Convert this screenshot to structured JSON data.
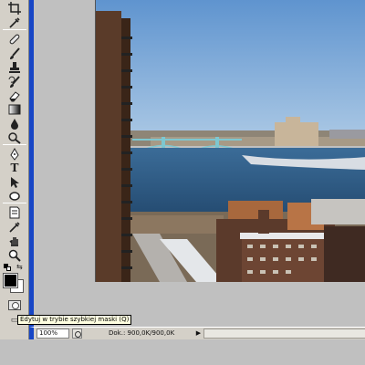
{
  "tooltip": {
    "text": "Edytuj w trybie szybkiej maski (Q)"
  },
  "statusbar": {
    "zoom": "100%",
    "doc_size": "Dok.: 900,0K/900,0K"
  },
  "toolbox": {
    "foreground_color": "#000000",
    "background_color": "#ffffff",
    "tools": [
      "crop-icon",
      "eyedropper-icon",
      "healing-brush-icon",
      "brush-icon",
      "clone-stamp-icon",
      "history-brush-icon",
      "eraser-icon",
      "gradient-icon",
      "blur-icon",
      "dodge-icon",
      "pen-icon",
      "type-icon",
      "path-selection-icon",
      "shape-icon",
      "notes-icon",
      "eyedropper-2-icon",
      "hand-icon",
      "zoom-icon"
    ],
    "type_glyph": "T"
  },
  "colors": {
    "window_accent": "#1746c6",
    "sky": "#6f9fd0",
    "water": "#2f5c85"
  }
}
